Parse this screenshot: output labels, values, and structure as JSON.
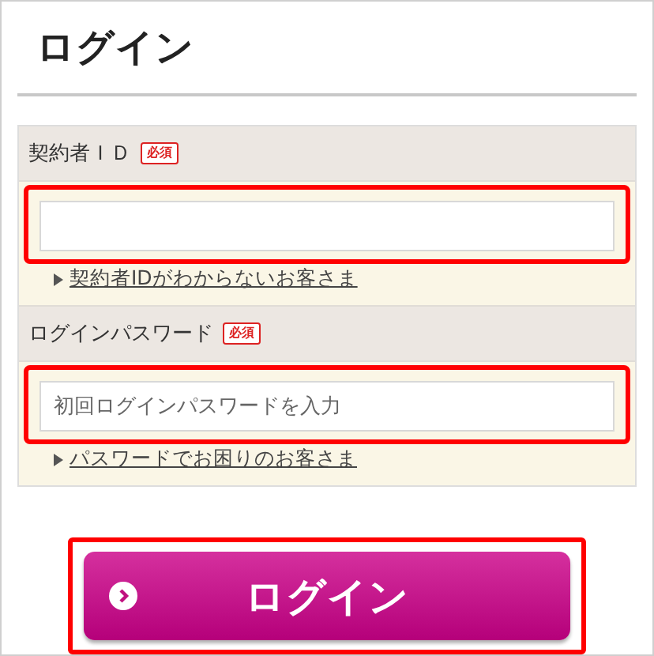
{
  "title": "ログイン",
  "fields": [
    {
      "label": "契約者ＩＤ",
      "badge": "必須",
      "link": "契約者IDがわからないお客さま",
      "highlighted": true
    },
    {
      "label": "ログインパスワード",
      "badge": "必須",
      "placeholder": "初回ログインパスワードを入力",
      "link": "パスワードでお困りのお客さま",
      "highlighted": true
    }
  ],
  "button": {
    "label": "ログイン",
    "highlighted": true
  }
}
